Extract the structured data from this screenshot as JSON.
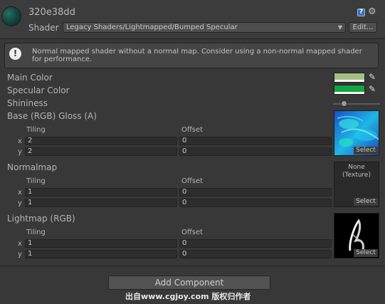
{
  "header": {
    "material_name": "320e38dd",
    "shader_label": "Shader",
    "shader_value": "Legacy Shaders/Lightmapped/Bumped Specular",
    "edit_label": "Edit...",
    "help_icon": "help-icon",
    "gear_icon": "gear-icon"
  },
  "warning": {
    "icon": "exclamation-icon",
    "text": "Normal mapped shader without a normal map. Consider using a non-normal mapped shader for performance."
  },
  "properties": {
    "main_color": {
      "label": "Main Color",
      "color": "#a3bf86"
    },
    "specular_color": {
      "label": "Specular Color",
      "color": "#12a641"
    },
    "shininess": {
      "label": "Shininess",
      "value": 0.2
    },
    "base": {
      "label": "Base (RGB) Gloss (A)",
      "tiling_label": "Tiling",
      "offset_label": "Offset",
      "tiling_x": "2",
      "tiling_y": "2",
      "offset_x": "0",
      "offset_y": "0",
      "select_label": "Select"
    },
    "normalmap": {
      "label": "Normalmap",
      "tiling_label": "Tiling",
      "offset_label": "Offset",
      "tiling_x": "1",
      "tiling_y": "1",
      "offset_x": "0",
      "offset_y": "0",
      "none_text": "None\n(Texture)",
      "none_line1": "None",
      "none_line2": "(Texture)",
      "select_label": "Select"
    },
    "lightmap": {
      "label": "Lightmap (RGB)",
      "tiling_label": "Tiling",
      "offset_label": "Offset",
      "tiling_x": "1",
      "tiling_y": "1",
      "offset_x": "0",
      "offset_y": "0",
      "select_label": "Select"
    },
    "axis_x": "x",
    "axis_y": "y"
  },
  "footer": {
    "add_component": "Add Component",
    "watermark": "出自www.cgjoy.com 版权归作者"
  }
}
